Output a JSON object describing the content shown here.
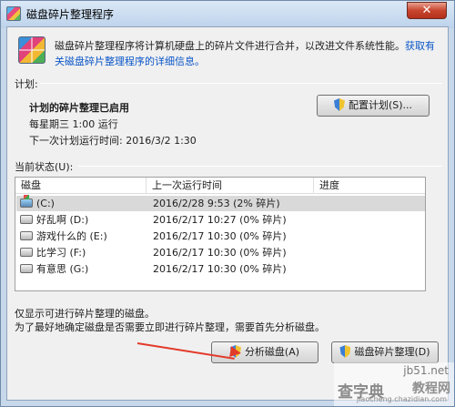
{
  "window": {
    "title": "磁盘碎片整理程序",
    "close_label": "✕"
  },
  "intro": {
    "text": "磁盘碎片整理程序将计算机硬盘上的碎片文件进行合并，以改进文件系统性能。",
    "link": "获取有关磁盘碎片整理程序的详细信息。"
  },
  "schedule": {
    "section_label": "计划:",
    "status": "计划的碎片整理已启用",
    "when": "每星期三 1:00 运行",
    "next_run": "下一次计划运行时间: 2016/3/2 1:30",
    "configure_button": "配置计划(S)..."
  },
  "status": {
    "section_label": "当前状态(U):",
    "columns": [
      "磁盘",
      "上一次运行时间",
      "进度"
    ],
    "disks": [
      {
        "name": "(C:)",
        "last_run": "2016/2/28 9:53 (2% 碎片)",
        "progress": "",
        "system": true
      },
      {
        "name": "好乱啊 (D:)",
        "last_run": "2016/2/17 10:27 (0% 碎片)",
        "progress": "",
        "system": false
      },
      {
        "name": "游戏什么的 (E:)",
        "last_run": "2016/2/17 10:30 (0% 碎片)",
        "progress": "",
        "system": false
      },
      {
        "name": "比学习 (F:)",
        "last_run": "2016/2/17 10:30 (0% 碎片)",
        "progress": "",
        "system": false
      },
      {
        "name": "有意思 (G:)",
        "last_run": "2016/2/17 10:30 (0% 碎片)",
        "progress": "",
        "system": false
      }
    ]
  },
  "footer": {
    "note1": "仅显示可进行碎片整理的磁盘。",
    "note2": "为了最好地确定磁盘是否需要立即进行碎片整理，需要首先分析磁盘。",
    "analyze_button": "分析磁盘(A)",
    "defrag_button": "磁盘碎片整理(D)"
  },
  "watermark": {
    "site": "jb51.net",
    "brand": "查字典",
    "cn": "教程网",
    "url": "jiaocheng.chazidian.com"
  }
}
